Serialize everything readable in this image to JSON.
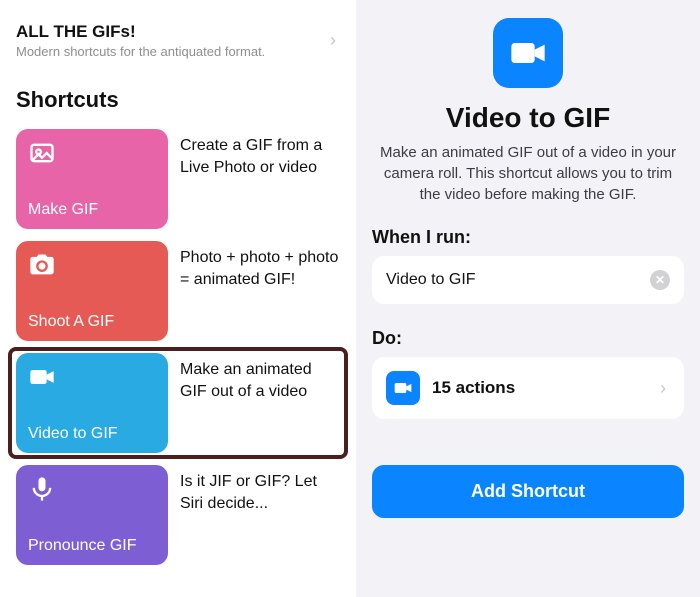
{
  "left": {
    "header": {
      "title": "ALL THE GIFs!",
      "subtitle": "Modern shortcuts for the antiquated format."
    },
    "section_title": "Shortcuts",
    "items": [
      {
        "label": "Make GIF",
        "desc": "Create a GIF from a Live Photo or video"
      },
      {
        "label": "Shoot A GIF",
        "desc": "Photo + photo + photo = animated GIF!"
      },
      {
        "label": "Video to GIF",
        "desc": "Make an animated GIF out of a video"
      },
      {
        "label": "Pronounce GIF",
        "desc": "Is it JIF or GIF? Let Siri decide..."
      }
    ]
  },
  "right": {
    "title": "Video to GIF",
    "description": "Make an animated GIF out of a video in your camera roll. This shortcut allows you to trim the video before making the GIF.",
    "when_label": "When I run:",
    "when_value": "Video to GIF",
    "do_label": "Do:",
    "actions_text": "15 actions",
    "add_button": "Add Shortcut"
  }
}
